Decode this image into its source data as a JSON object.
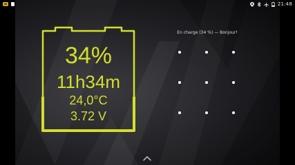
{
  "status_bar": {
    "notification_icons": [
      "app-notification-icon",
      "sd-card-icon"
    ],
    "system_icons": [
      "location-icon",
      "bluetooth-icon",
      "airplane-mode-icon",
      "battery-icon"
    ],
    "time": "21:48"
  },
  "battery_widget": {
    "percent": "34%",
    "time_remaining": "11h34m",
    "temperature": "24,0°C",
    "voltage": "3.72 V",
    "fill_level": 0.34,
    "accent_color": "#d4de2b"
  },
  "lock_screen": {
    "owner_message": "En charge (34 %) — Bonjour!",
    "pattern_dots": 9,
    "unlock_icon": "chevron-up-icon"
  }
}
